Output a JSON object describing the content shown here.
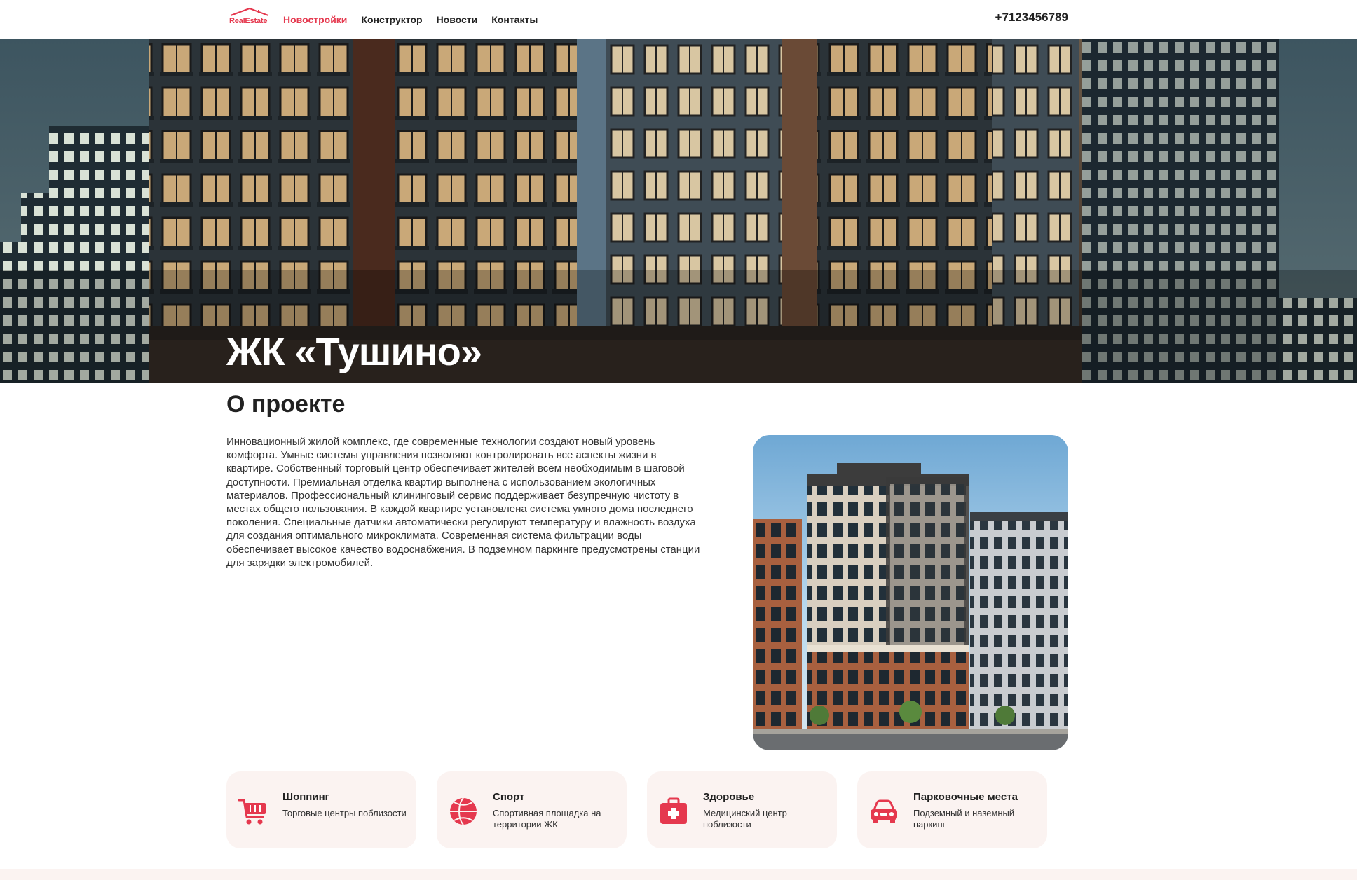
{
  "header": {
    "logo_text": "RealEstate",
    "nav": [
      {
        "label": "Новостройки",
        "active": true
      },
      {
        "label": "Конструктор",
        "active": false
      },
      {
        "label": "Новости",
        "active": false
      },
      {
        "label": "Контакты",
        "active": false
      }
    ],
    "phone": "+7123456789"
  },
  "hero": {
    "title": "ЖК «Тушино»"
  },
  "about": {
    "title": "О проекте",
    "text": "Инновационный жилой комплекс, где современные технологии создают новый уровень комфорта. Умные системы управления позволяют контролировать все аспекты жизни в квартире. Собственный торговый центр обеспечивает жителей всем необходимым в шаговой доступности. Премиальная отделка квартир выполнена с использованием экологичных материалов. Профессиональный клининговый сервис поддерживает безупречную чистоту в местах общего пользования. В каждой квартире установлена система умного дома последнего поколения. Специальные датчики автоматически регулируют температуру и влажность воздуха для создания оптимального микроклимата. Современная система фильтрации воды обеспечивает высокое качество водоснабжения. В подземном паркинге предусмотрены станции для зарядки электромобилей."
  },
  "features": [
    {
      "title": "Шоппинг",
      "desc": "Торговые центры поблизости",
      "icon": "shopping-cart-icon"
    },
    {
      "title": "Спорт",
      "desc": "Спортивная площадка на территории ЖК",
      "icon": "basketball-icon"
    },
    {
      "title": "Здоровье",
      "desc": "Медицинский центр поблизости",
      "icon": "medical-kit-icon"
    },
    {
      "title": "Парковочные места",
      "desc": "Подземный и наземный паркинг",
      "icon": "car-icon"
    }
  ],
  "colors": {
    "accent": "#e5384e",
    "card_bg": "#fbf3f1",
    "text": "#222222"
  }
}
